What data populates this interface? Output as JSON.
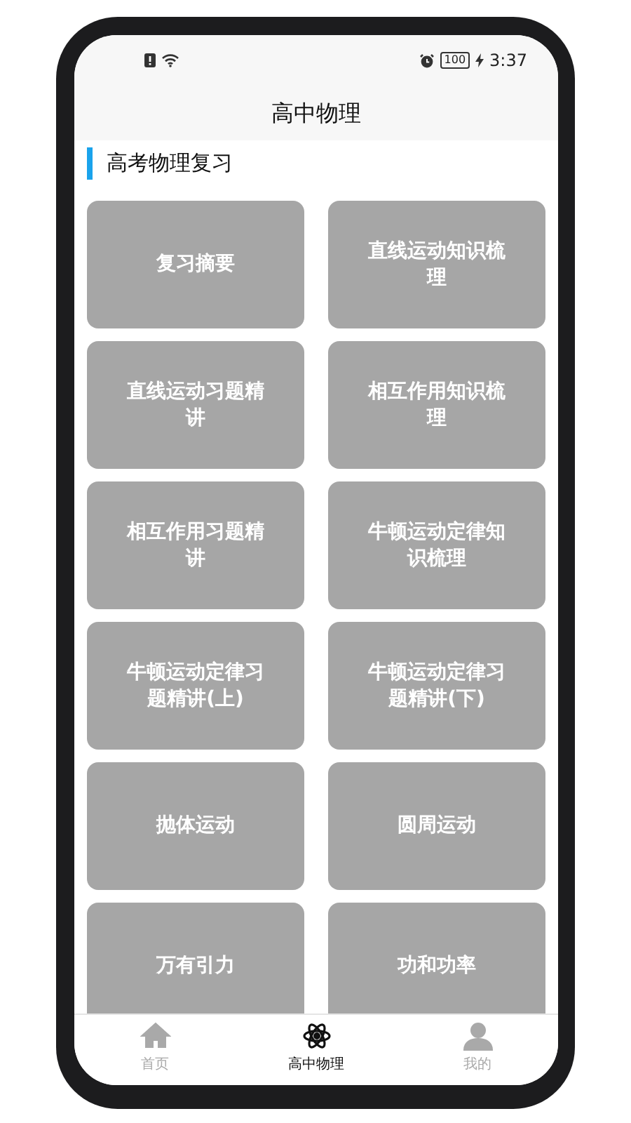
{
  "status_bar": {
    "battery": "100",
    "time": "3:37"
  },
  "title": "高中物理",
  "section": {
    "title": "高考物理复习"
  },
  "topic_rows": [
    {
      "topics": [
        {
          "label": "复习摘要"
        },
        {
          "label": "直线运动知识梳理"
        }
      ]
    },
    {
      "topics": [
        {
          "label": "直线运动习题精讲"
        },
        {
          "label": "相互作用知识梳理"
        }
      ]
    },
    {
      "topics": [
        {
          "label": "相互作用习题精讲"
        },
        {
          "label": "牛顿运动定律知识梳理"
        }
      ]
    },
    {
      "topics": [
        {
          "label": "牛顿运动定律习题精讲(上)"
        },
        {
          "label": "牛顿运动定律习题精讲(下)"
        }
      ]
    },
    {
      "topics": [
        {
          "label": "抛体运动"
        },
        {
          "label": "圆周运动"
        }
      ]
    },
    {
      "topics": [
        {
          "label": "万有引力"
        },
        {
          "label": "功和功率"
        }
      ]
    }
  ],
  "tabs": [
    {
      "label": "首页",
      "kind": "home",
      "selected": false
    },
    {
      "label": "高中物理",
      "kind": "physics",
      "selected": true
    },
    {
      "label": "我的",
      "kind": "profile",
      "selected": false
    }
  ]
}
